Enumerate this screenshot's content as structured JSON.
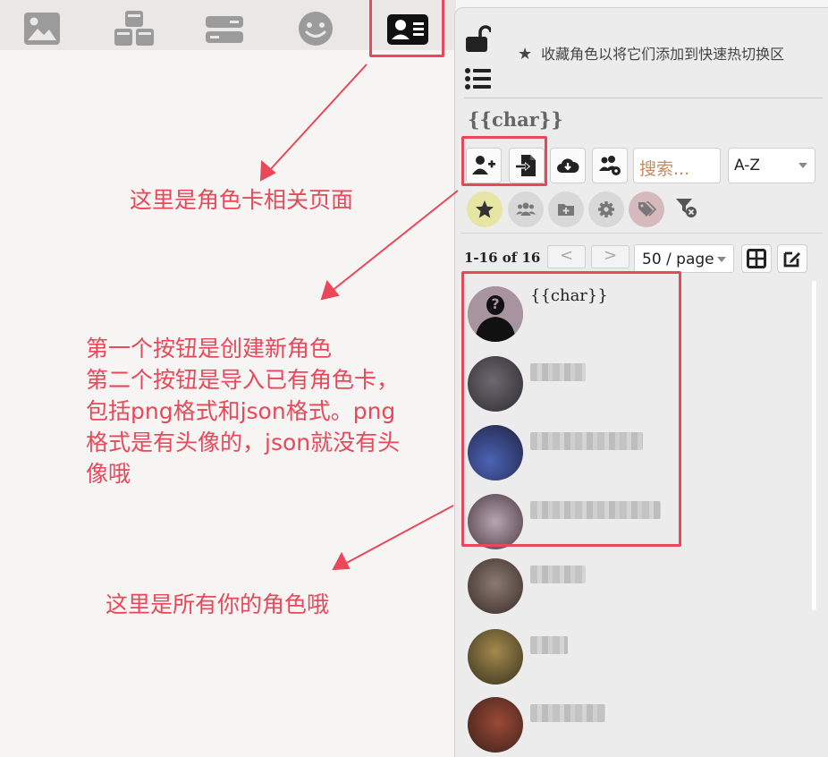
{
  "toolbar": {
    "icons": [
      {
        "name": "image-icon"
      },
      {
        "name": "extensions-cubes-icon"
      },
      {
        "name": "server-connection-icon"
      },
      {
        "name": "smiley-icon"
      },
      {
        "name": "character-card-icon",
        "active": true
      }
    ]
  },
  "annotations": {
    "char_page": "这里是角色卡相关页面",
    "buttons": "第一个按钮是创建新角色\n第二个按钮是导入已有角色卡，\n包括png格式和json格式。png\n格式是有头像的，json就没有头\n像哦",
    "all_chars": "这里是所有你的角色哦"
  },
  "panel": {
    "fav_hint": "收藏角色以将它们添加到快速热切换区",
    "title": "{{char}}",
    "search_placeholder": "搜索...",
    "sort": "A-Z",
    "pager": {
      "count": "1-16  of  16",
      "prev": "<",
      "next": ">",
      "page_size": "50 / page"
    },
    "characters": [
      {
        "name": "{{char}}",
        "avatar": "placeholder-silhouette"
      },
      {
        "name": "",
        "blurred": true
      },
      {
        "name": "",
        "blurred": true
      },
      {
        "name": "",
        "blurred": true
      },
      {
        "name": "",
        "blurred": true
      },
      {
        "name": "",
        "blurred": true
      },
      {
        "name": "",
        "blurred": true
      }
    ]
  },
  "colors": {
    "annotation": "#e8485a",
    "search_text": "#c7895f",
    "favorite_filter": "#e6e5a3",
    "tag_filter": "#d6b9bd"
  }
}
